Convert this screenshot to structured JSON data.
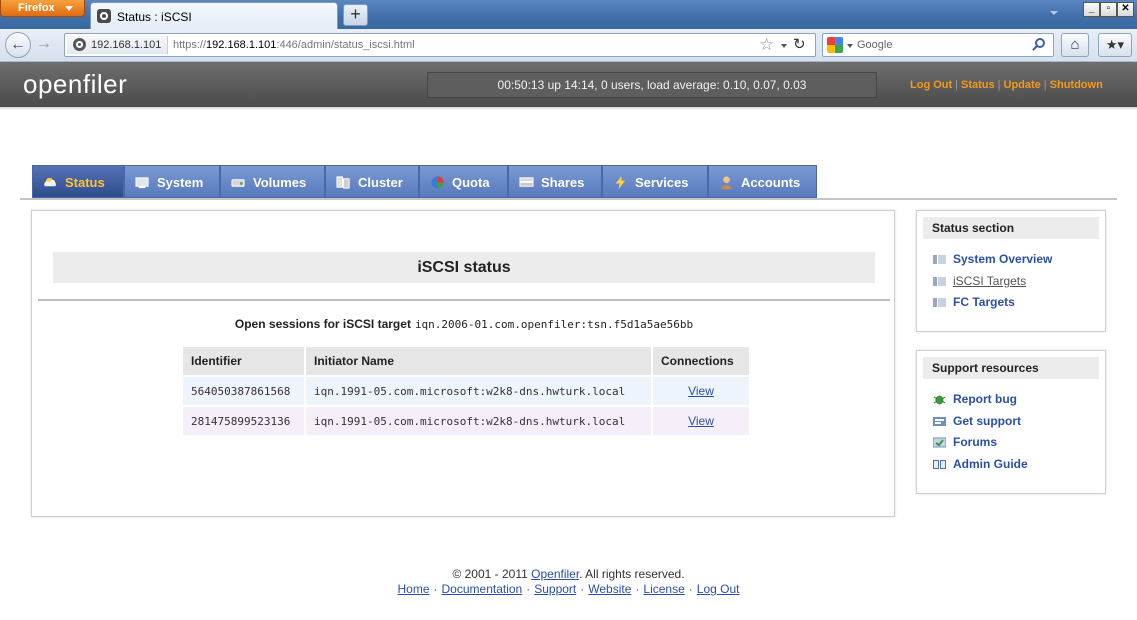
{
  "browser": {
    "menu_label": "Firefox",
    "tab_title": "Status : iSCSI",
    "new_tab_label": "+",
    "site_identity": "192.168.1.101",
    "url_prefix": "https://",
    "url_host": "192.168.1.101",
    "url_rest": ":446/admin/status_iscsi.html",
    "search_engine": "Google",
    "search_placeholder": "Google",
    "icons": [
      "back-icon",
      "forward-icon",
      "star-icon",
      "reload-icon",
      "search-icon",
      "home-icon",
      "bookmarks-icon"
    ]
  },
  "header": {
    "logo": "openfiler",
    "uptime": "00:50:13 up 14:14, 0 users, load average: 0.10, 0.07, 0.03",
    "links": [
      "Log Out",
      "Status",
      "Update",
      "Shutdown"
    ],
    "link_color": "#f39a1a"
  },
  "tabs": [
    {
      "label": "Status",
      "icon": "status-icon",
      "active": true
    },
    {
      "label": "System",
      "icon": "system-icon",
      "active": false
    },
    {
      "label": "Volumes",
      "icon": "volumes-icon",
      "active": false
    },
    {
      "label": "Cluster",
      "icon": "cluster-icon",
      "active": false
    },
    {
      "label": "Quota",
      "icon": "quota-icon",
      "active": false
    },
    {
      "label": "Shares",
      "icon": "shares-icon",
      "active": false
    },
    {
      "label": "Services",
      "icon": "services-icon",
      "active": false
    },
    {
      "label": "Accounts",
      "icon": "accounts-icon",
      "active": false
    }
  ],
  "main": {
    "title": "iSCSI status",
    "sessions_label": "Open sessions for iSCSI target",
    "target_name": "iqn.2006-01.com.openfiler:tsn.f5d1a5ae56bb",
    "table": {
      "headers": [
        "Identifier",
        "Initiator Name",
        "Connections"
      ],
      "rows": [
        {
          "identifier": "564050387861568",
          "initiator": "iqn.1991-05.com.microsoft:w2k8-dns.hwturk.local",
          "connections": "View"
        },
        {
          "identifier": "281475899523136",
          "initiator": "iqn.1991-05.com.microsoft:w2k8-dns.hwturk.local",
          "connections": "View"
        }
      ]
    }
  },
  "status_section": {
    "title": "Status section",
    "items": [
      "System Overview",
      "iSCSI Targets",
      "FC Targets"
    ],
    "current": "iSCSI Targets"
  },
  "support_resources": {
    "title": "Support resources",
    "items": [
      "Report bug",
      "Get support",
      "Forums",
      "Admin Guide"
    ]
  },
  "footer": {
    "copyright_prefix": "© 2001 - 2011",
    "copyright_link": "Openfiler",
    "copyright_suffix": ". All rights reserved.",
    "links": [
      "Home",
      "Documentation",
      "Support",
      "Website",
      "License",
      "Log Out"
    ]
  },
  "colors": {
    "tab_bg": "#5879bd",
    "active_tab_text": "#ffc436",
    "link": "#2a4fa8",
    "header_bg": "#4b4b4b"
  }
}
